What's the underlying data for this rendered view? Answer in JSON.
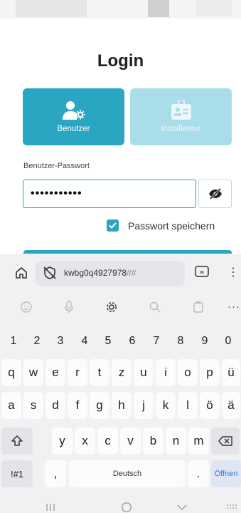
{
  "login": {
    "title": "Login",
    "roles": [
      {
        "label": "Benutzer",
        "icon": "user-gear-icon",
        "active": true
      },
      {
        "label": "Installateur",
        "icon": "id-badge-icon",
        "active": false
      }
    ],
    "password_label": "Benutzer-Passwort",
    "password_value": "•••••••••••",
    "save_password_label": "Passwort speichern",
    "save_password_checked": true
  },
  "browser": {
    "url": "kwbg0q4927978",
    "url_suffix": "//#"
  },
  "keyboard": {
    "number_row": [
      "1",
      "2",
      "3",
      "4",
      "5",
      "6",
      "7",
      "8",
      "9",
      "0"
    ],
    "row1": [
      "q",
      "w",
      "e",
      "r",
      "t",
      "z",
      "u",
      "i",
      "o",
      "p",
      "ü"
    ],
    "row2": [
      "a",
      "s",
      "d",
      "f",
      "g",
      "h",
      "j",
      "k",
      "l",
      "ö",
      "ä"
    ],
    "row3": [
      "y",
      "x",
      "c",
      "v",
      "b",
      "n",
      "m"
    ],
    "symbols_label": "!#1",
    "comma_label": ",",
    "space_label": "Deutsch",
    "period_label": ".",
    "enter_label": "Öffnen"
  },
  "colors": {
    "accent": "#2aa6c2",
    "accent_light": "#a9dde9"
  }
}
